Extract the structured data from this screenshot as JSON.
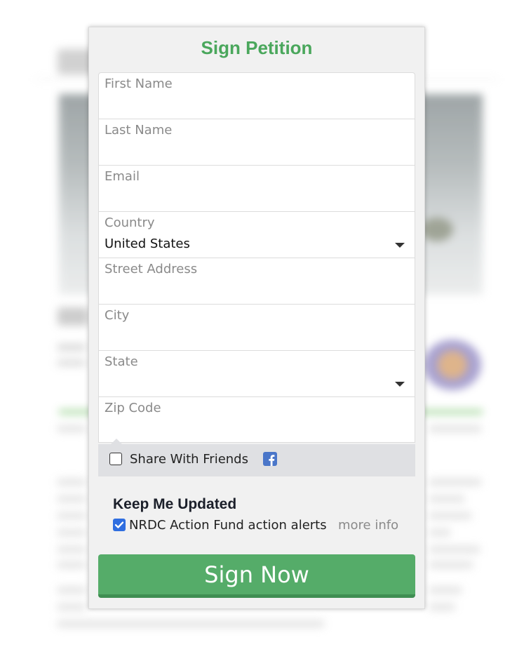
{
  "petition": {
    "title": "Sign Petition",
    "fields": [
      {
        "label": "First Name",
        "value": ""
      },
      {
        "label": "Last Name",
        "value": ""
      },
      {
        "label": "Email",
        "value": ""
      },
      {
        "label": "Country",
        "value": "United States"
      },
      {
        "label": "Street Address",
        "value": ""
      },
      {
        "label": "City",
        "value": ""
      },
      {
        "label": "State",
        "value": ""
      },
      {
        "label": "Zip Code",
        "value": ""
      }
    ],
    "share": {
      "label": "Share With Friends",
      "checked": false,
      "icon": "facebook-icon"
    },
    "updates": {
      "title": "Keep Me Updated",
      "alerts_label": "NRDC Action Fund action alerts",
      "alerts_checked": true,
      "more_info": "more info"
    },
    "submit_label": "Sign Now"
  },
  "colors": {
    "title_green": "#4aa75c",
    "button_green": "#55ac69",
    "checkbox_blue": "#2f6ee0",
    "facebook_blue": "#4a76c9"
  }
}
